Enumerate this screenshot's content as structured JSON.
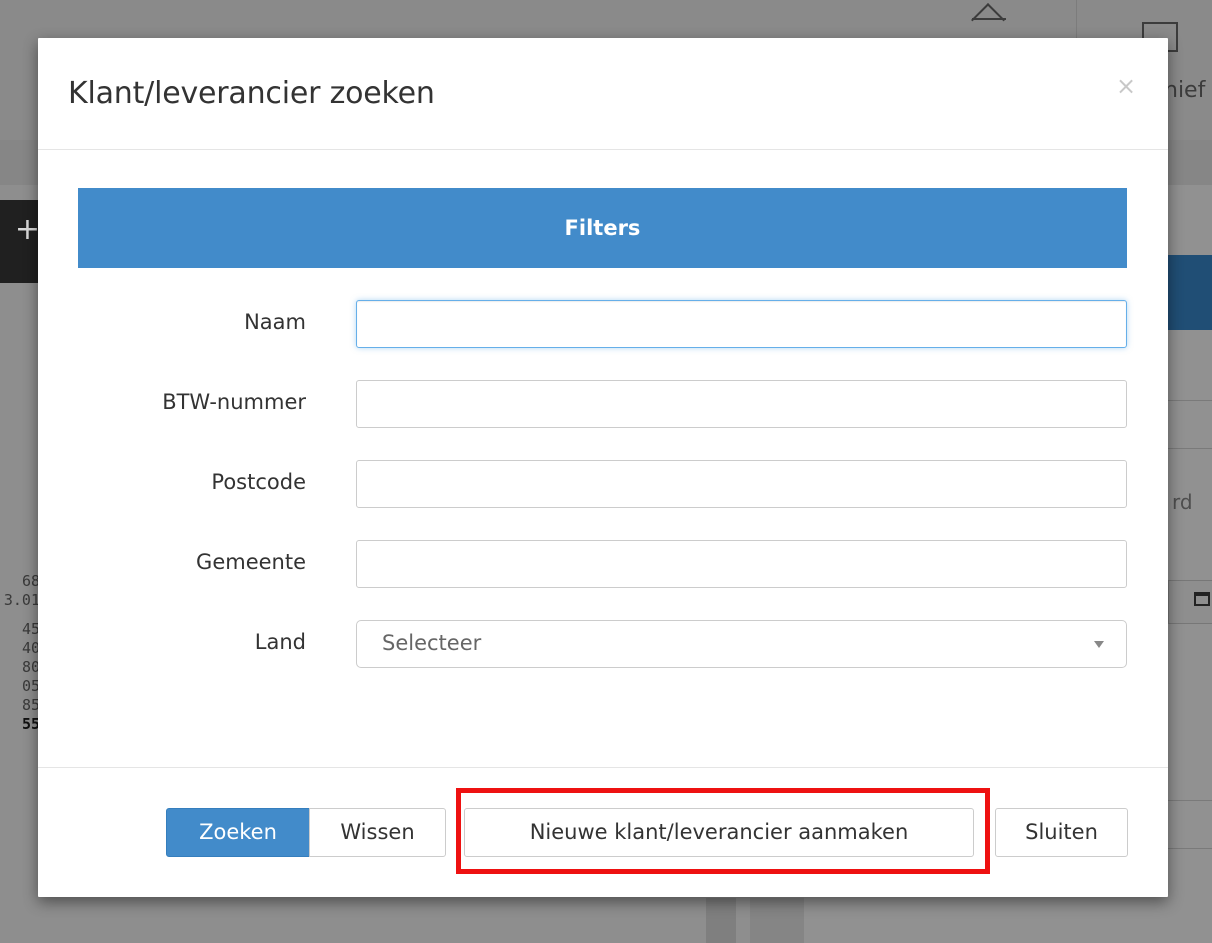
{
  "background": {
    "archive_label_fragment": "hief",
    "right_text_fragment": "rd",
    "left_numbers": [
      "68",
      "3.01",
      "45",
      "40",
      "80",
      "05",
      "85",
      "55"
    ]
  },
  "modal": {
    "title": "Klant/leverancier zoeken",
    "close_symbol": "×",
    "filters_header": "Filters",
    "fields": {
      "naam_label": "Naam",
      "naam_value": "",
      "btw_label": "BTW-nummer",
      "btw_value": "",
      "postcode_label": "Postcode",
      "postcode_value": "",
      "gemeente_label": "Gemeente",
      "gemeente_value": "",
      "land_label": "Land",
      "land_selected": "Selecteer"
    },
    "buttons": {
      "zoeken": "Zoeken",
      "wissen": "Wissen",
      "nieuw": "Nieuwe klant/leverancier aanmaken",
      "sluiten": "Sluiten"
    }
  },
  "colors": {
    "primary": "#428bca",
    "highlight": "#ee1111"
  }
}
